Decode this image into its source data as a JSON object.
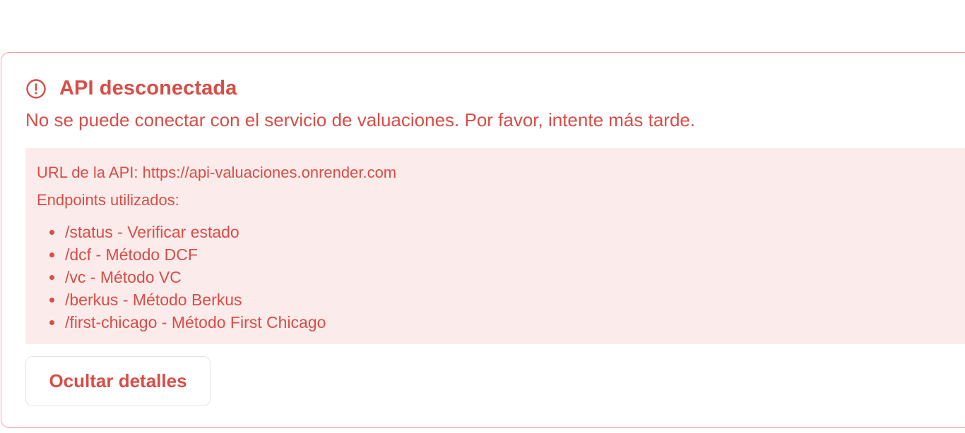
{
  "alert": {
    "icon": "alert-circle-icon",
    "title": "API desconectada",
    "description": "No se puede conectar con el servicio de valuaciones. Por favor, intente más tarde.",
    "colors": {
      "accent": "#d84d46",
      "border": "#f0a59e",
      "details_background": "#fbebea"
    }
  },
  "details": {
    "api_url_line": "URL de la API: https://api-valuaciones.onrender.com",
    "endpoints_heading": "Endpoints utilizados:",
    "endpoints": [
      "/status - Verificar estado",
      "/dcf - Método DCF",
      "/vc - Método VC",
      "/berkus - Método Berkus",
      "/first-chicago - Método First Chicago"
    ]
  },
  "actions": {
    "toggle_details_label": "Ocultar detalles"
  }
}
